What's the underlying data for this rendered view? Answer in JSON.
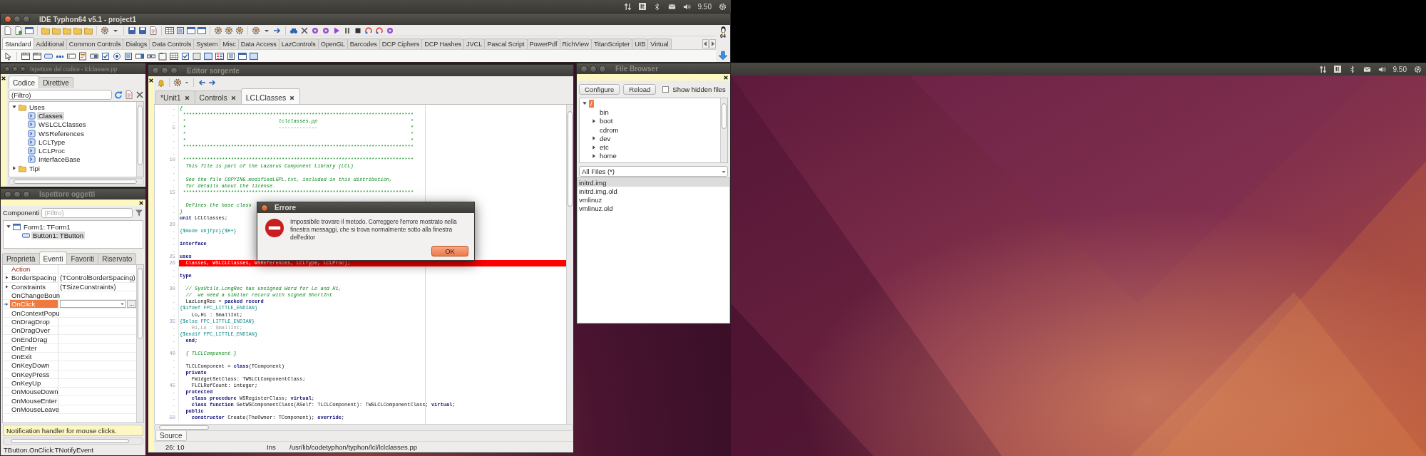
{
  "top_panels": [
    {
      "keyboard": "It",
      "clock": "9.50"
    },
    {
      "keyboard": "It",
      "clock": "9.50"
    }
  ],
  "ide_window": {
    "title": "IDE Typhon64 v5.1 - project1",
    "arch_label": "64",
    "palette_tabs": [
      {
        "label": "Standard",
        "selected": true
      },
      {
        "label": "Additional",
        "selected": false
      },
      {
        "label": "Common Controls",
        "selected": false
      },
      {
        "label": "Dialogs",
        "selected": false
      },
      {
        "label": "Data Controls",
        "selected": false
      },
      {
        "label": "System",
        "selected": false
      },
      {
        "label": "Misc",
        "selected": false
      },
      {
        "label": "Data Access",
        "selected": false
      },
      {
        "label": "LazControls",
        "selected": false
      },
      {
        "label": "OpenGL",
        "selected": false
      },
      {
        "label": "Barcodes",
        "selected": false
      },
      {
        "label": "DCP Ciphers",
        "selected": false
      },
      {
        "label": "DCP Hashes",
        "selected": false
      },
      {
        "label": "JVCL",
        "selected": false
      },
      {
        "label": "Pascal Script",
        "selected": false
      },
      {
        "label": "PowerPdf",
        "selected": false
      },
      {
        "label": "RichView",
        "selected": false
      },
      {
        "label": "TitanScripter",
        "selected": false
      },
      {
        "label": "UIB",
        "selected": false
      },
      {
        "label": "Virtual",
        "selected": false
      }
    ]
  },
  "code_explorer": {
    "title": "Ispettore del codice - lclclasses.pp",
    "tabs": [
      {
        "label": "Codice",
        "selected": true
      },
      {
        "label": "Direttive",
        "selected": false
      }
    ],
    "filter": {
      "value": "(Filtro)"
    },
    "tree": [
      {
        "label": "Uses",
        "expanded": true,
        "selected": false,
        "children": [
          {
            "label": "Classes",
            "selected": true
          },
          {
            "label": "WSLCLClasses",
            "selected": false
          },
          {
            "label": "WSReferences",
            "selected": false
          },
          {
            "label": "LCLType",
            "selected": false
          },
          {
            "label": "LCLProc",
            "selected": false
          },
          {
            "label": "InterfaceBase",
            "selected": false
          }
        ]
      },
      {
        "label": "Tipi",
        "expanded": false,
        "selected": false
      }
    ]
  },
  "object_inspector": {
    "title": "Ispettore oggetti",
    "filter_label": "Componenti",
    "filter": {
      "placeholder": "(Filtro)"
    },
    "tree": [
      {
        "label": "Form1: TForm1",
        "expanded": true,
        "selected": false,
        "children": [
          {
            "label": "Button1: TButton",
            "selected": true
          }
        ]
      }
    ],
    "tabs": [
      {
        "label": "Proprietà",
        "selected": false
      },
      {
        "label": "Eventi",
        "selected": true
      },
      {
        "label": "Favoriti",
        "selected": false
      },
      {
        "label": "Riservato",
        "selected": false
      }
    ],
    "rows": [
      {
        "name": "Action",
        "kind": "reference",
        "selected": false
      },
      {
        "name": "BorderSpacing",
        "value": "(TControlBorderSpacing)",
        "kind": "expandable",
        "selected": false
      },
      {
        "name": "Constraints",
        "value": "(TSizeConstraints)",
        "kind": "expandable",
        "selected": false
      },
      {
        "name": "OnChangeBoun",
        "kind": "event",
        "selected": false
      },
      {
        "name": "OnClick",
        "kind": "event",
        "selected": true,
        "button_label": "..."
      },
      {
        "name": "OnContextPopu",
        "kind": "event",
        "selected": false
      },
      {
        "name": "OnDragDrop",
        "kind": "event",
        "selected": false
      },
      {
        "name": "OnDragOver",
        "kind": "event",
        "selected": false
      },
      {
        "name": "OnEndDrag",
        "kind": "event",
        "selected": false
      },
      {
        "name": "OnEnter",
        "kind": "event",
        "selected": false
      },
      {
        "name": "OnExit",
        "kind": "event",
        "selected": false
      },
      {
        "name": "OnKeyDown",
        "kind": "event",
        "selected": false
      },
      {
        "name": "OnKeyPress",
        "kind": "event",
        "selected": false
      },
      {
        "name": "OnKeyUp",
        "kind": "event",
        "selected": false
      },
      {
        "name": "OnMouseDown",
        "kind": "event",
        "selected": false
      },
      {
        "name": "OnMouseEnter",
        "kind": "event",
        "selected": false
      },
      {
        "name": "OnMouseLeave",
        "kind": "event",
        "selected": false
      }
    ],
    "hint": "Notification handler for mouse clicks.",
    "status": "TButton.OnClick:TNotifyEvent"
  },
  "editor": {
    "title": "Editor sorgente",
    "tabs": [
      {
        "label": "*Unit1",
        "selected": false
      },
      {
        "label": "Controls",
        "selected": false
      },
      {
        "label": "LCLClasses",
        "selected": true
      }
    ],
    "lines": [
      {
        "gutter": ".",
        "error": false,
        "segments": [
          {
            "kind": "comment",
            "text": "{"
          }
        ]
      },
      {
        "gutter": ".",
        "error": false,
        "segments": [
          {
            "kind": "comment",
            "text": " *****************************************************************************"
          }
        ]
      },
      {
        "gutter": ".",
        "error": false,
        "segments": [
          {
            "kind": "comment",
            "text": " *                               lclclasses.pp                               *"
          }
        ]
      },
      {
        "gutter": "5",
        "error": false,
        "segments": [
          {
            "kind": "comment",
            "text": " *                               -------------                               *"
          }
        ]
      },
      {
        "gutter": ".",
        "error": false,
        "segments": [
          {
            "kind": "comment",
            "text": " *                                                                           *"
          }
        ]
      },
      {
        "gutter": ".",
        "error": false,
        "segments": [
          {
            "kind": "comment",
            "text": " *                                                                           *"
          }
        ]
      },
      {
        "gutter": ".",
        "error": false,
        "segments": [
          {
            "kind": "comment",
            "text": " *****************************************************************************"
          }
        ]
      },
      {
        "gutter": ".",
        "error": false
      },
      {
        "gutter": "10",
        "error": false,
        "segments": [
          {
            "kind": "comment",
            "text": " *****************************************************************************"
          }
        ]
      },
      {
        "gutter": ".",
        "error": false,
        "segments": [
          {
            "kind": "comment",
            "text": "  This file is part of the Lazarus Component Library (LCL)"
          }
        ]
      },
      {
        "gutter": ".",
        "error": false
      },
      {
        "gutter": ".",
        "error": false,
        "segments": [
          {
            "kind": "comment",
            "text": "  See the file COPYING.modifiedLGPL.txt, included in this distribution,"
          }
        ]
      },
      {
        "gutter": ".",
        "error": false,
        "segments": [
          {
            "kind": "comment",
            "text": "  for details about the license."
          }
        ]
      },
      {
        "gutter": "15",
        "error": false,
        "segments": [
          {
            "kind": "comment",
            "text": " *****************************************************************************"
          }
        ]
      },
      {
        "gutter": ".",
        "error": false
      },
      {
        "gutter": ".",
        "error": false,
        "segments": [
          {
            "kind": "comment",
            "text": "  Defines the base class"
          }
        ]
      },
      {
        "gutter": ".",
        "error": false,
        "segments": [
          {
            "kind": "comment",
            "text": "}"
          }
        ]
      },
      {
        "gutter": ".",
        "error": false,
        "segments": [
          {
            "kind": "keyword",
            "text": "unit"
          },
          {
            "kind": "plain",
            "text": " LCLClasses;"
          }
        ]
      },
      {
        "gutter": "20",
        "error": false
      },
      {
        "gutter": ".",
        "error": false,
        "segments": [
          {
            "kind": "directive",
            "text": "{$mode objfpc}{$H+}"
          }
        ]
      },
      {
        "gutter": ".",
        "error": false
      },
      {
        "gutter": ".",
        "error": false,
        "segments": [
          {
            "kind": "keyword",
            "text": "interface"
          }
        ]
      },
      {
        "gutter": ".",
        "error": false
      },
      {
        "gutter": "25",
        "error": false,
        "segments": [
          {
            "kind": "keyword",
            "text": "uses"
          }
        ]
      },
      {
        "gutter": "26",
        "error": true,
        "segments": [
          {
            "kind": "plain",
            "text": "  Classes, WSLCLClasses, WSReferences, LCLType, LCLProc);"
          }
        ]
      },
      {
        "gutter": ".",
        "error": false
      },
      {
        "gutter": ".",
        "error": false,
        "segments": [
          {
            "kind": "keyword",
            "text": "type"
          }
        ]
      },
      {
        "gutter": ".",
        "error": false
      },
      {
        "gutter": "30",
        "error": false,
        "segments": [
          {
            "kind": "comment",
            "text": "  // SysUtils.LongRec has unsigned Word for Lo and Hi,"
          }
        ]
      },
      {
        "gutter": ".",
        "error": false,
        "segments": [
          {
            "kind": "comment",
            "text": "  //  we need a similar record with signed ShortInt"
          }
        ]
      },
      {
        "gutter": ".",
        "error": false,
        "segments": [
          {
            "kind": "plain",
            "text": "  LazLongRec = "
          },
          {
            "kind": "keyword",
            "text": "packed record"
          }
        ]
      },
      {
        "gutter": ".",
        "error": false,
        "segments": [
          {
            "kind": "directive",
            "text": "{$ifdef FPC_LITTLE_ENDIAN}"
          }
        ]
      },
      {
        "gutter": ".",
        "error": false,
        "segments": [
          {
            "kind": "plain",
            "text": "    Lo,Hi : SmallInt;"
          }
        ]
      },
      {
        "gutter": "35",
        "error": false,
        "segments": [
          {
            "kind": "directive",
            "text": "{$else FPC_LITTLE_ENDIAN}"
          }
        ]
      },
      {
        "gutter": ".",
        "error": false,
        "segments": [
          {
            "kind": "inactive",
            "text": "    Hi,Lo : SmallInt;"
          }
        ]
      },
      {
        "gutter": ".",
        "error": false,
        "segments": [
          {
            "kind": "directive",
            "text": "{$endif FPC_LITTLE_ENDIAN}"
          }
        ]
      },
      {
        "gutter": ".",
        "error": false,
        "segments": [
          {
            "kind": "keyword",
            "text": "  end"
          },
          {
            "kind": "plain",
            "text": ";"
          }
        ]
      },
      {
        "gutter": ".",
        "error": false
      },
      {
        "gutter": "40",
        "error": false,
        "segments": [
          {
            "kind": "comment",
            "text": "  { TLCLComponent }"
          }
        ]
      },
      {
        "gutter": ".",
        "error": false
      },
      {
        "gutter": ".",
        "error": false,
        "segments": [
          {
            "kind": "plain",
            "text": "  TLCLComponent = "
          },
          {
            "kind": "keyword",
            "text": "class"
          },
          {
            "kind": "plain",
            "text": "(TComponent)"
          }
        ]
      },
      {
        "gutter": ".",
        "error": false,
        "segments": [
          {
            "kind": "keyword",
            "text": "  private"
          }
        ]
      },
      {
        "gutter": ".",
        "error": false,
        "segments": [
          {
            "kind": "plain",
            "text": "    FWidgetSetClass: TWSLCLComponentClass;"
          }
        ]
      },
      {
        "gutter": "45",
        "error": false,
        "segments": [
          {
            "kind": "plain",
            "text": "    FLCLRefCount: integer;"
          }
        ]
      },
      {
        "gutter": ".",
        "error": false,
        "segments": [
          {
            "kind": "keyword",
            "text": "  protected"
          }
        ]
      },
      {
        "gutter": ".",
        "error": false,
        "segments": [
          {
            "kind": "keyword",
            "text": "    class procedure"
          },
          {
            "kind": "plain",
            "text": " WSRegisterClass; "
          },
          {
            "kind": "keyword",
            "text": "virtual"
          },
          {
            "kind": "plain",
            "text": ";"
          }
        ]
      },
      {
        "gutter": ".",
        "error": false,
        "segments": [
          {
            "kind": "keyword",
            "text": "    class function"
          },
          {
            "kind": "plain",
            "text": " GetWSComponentClass(ASelf: TLCLComponent): TWSLCLComponentClass; "
          },
          {
            "kind": "keyword",
            "text": "virtual"
          },
          {
            "kind": "plain",
            "text": ";"
          }
        ]
      },
      {
        "gutter": ".",
        "error": false,
        "segments": [
          {
            "kind": "keyword",
            "text": "  public"
          }
        ]
      },
      {
        "gutter": "50",
        "error": false,
        "segments": [
          {
            "kind": "keyword",
            "text": "    constructor"
          },
          {
            "kind": "plain",
            "text": " Create(TheOwner: TComponent); "
          },
          {
            "kind": "keyword",
            "text": "override"
          },
          {
            "kind": "plain",
            "text": ";"
          }
        ]
      }
    ],
    "bottom_tab": "Source",
    "status": {
      "position": "26: 10",
      "mode": "Ins",
      "path": "/usr/lib/codetyphon/typhon/lcl/lclclasses.pp"
    }
  },
  "error_dialog": {
    "title": "Errore",
    "message": "Impossibile trovare il metodo. Correggere l'errore mostrato nella finestra messaggi, che si trova normalmente sotto alla finestra dell'editor",
    "button": "OK"
  },
  "file_browser": {
    "title": "File Browser",
    "buttons": [
      "Configure",
      "Reload"
    ],
    "show_hidden": {
      "label": "Show hidden files",
      "checked": false
    },
    "tree": [
      {
        "label": "/",
        "expanded": true,
        "selected": true,
        "children": [
          {
            "label": "bin",
            "selected": false
          },
          {
            "label": "boot",
            "expanded": false,
            "selected": false
          },
          {
            "label": "cdrom",
            "selected": false
          },
          {
            "label": "dev",
            "expanded": false,
            "selected": false
          },
          {
            "label": "etc",
            "expanded": false,
            "selected": false
          },
          {
            "label": "home",
            "expanded": false,
            "selected": false
          }
        ]
      }
    ],
    "filter": {
      "value": "All Files (*)"
    },
    "files": [
      {
        "name": "initrd.img",
        "selected": true
      },
      {
        "name": "initrd.img.old",
        "selected": false
      },
      {
        "name": "vmlinuz",
        "selected": false
      },
      {
        "name": "vmlinuz.old",
        "selected": false
      }
    ]
  }
}
